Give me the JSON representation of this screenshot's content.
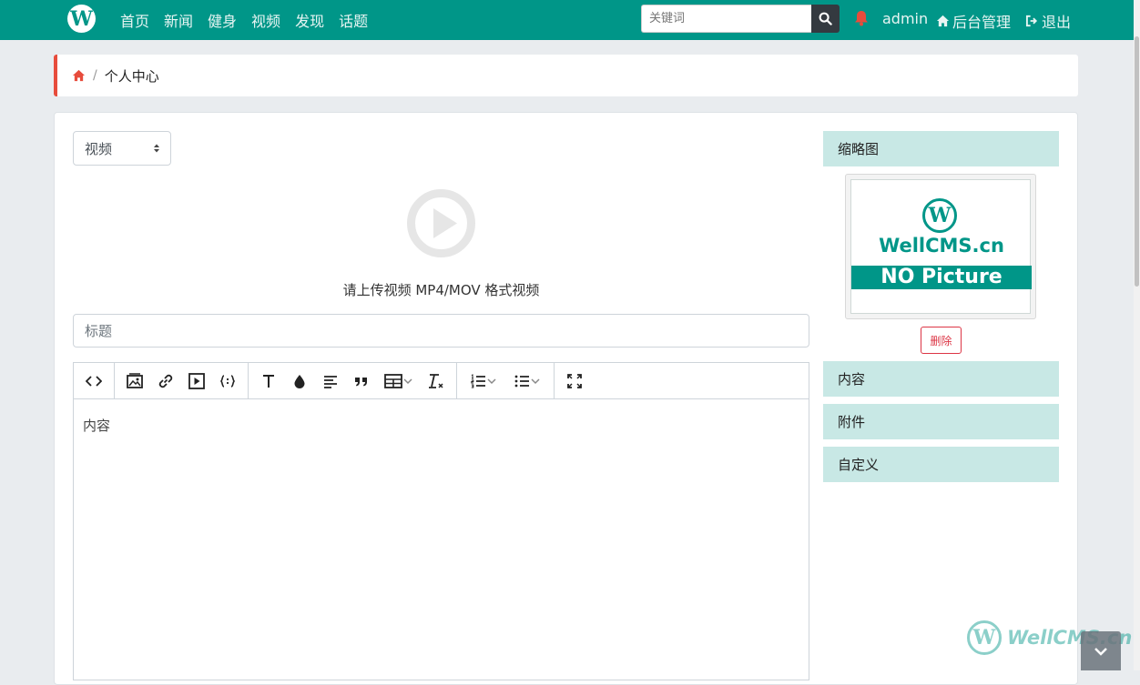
{
  "nav": {
    "logo_letter": "W",
    "links": [
      "首页",
      "新闻",
      "健身",
      "视频",
      "发现",
      "话题"
    ],
    "search_placeholder": "关键词",
    "username": "admin",
    "admin_label": "后台管理",
    "logout_label": "退出",
    "brand_color": "#009688"
  },
  "breadcrumb": {
    "separator": "/",
    "current": "个人中心"
  },
  "form": {
    "type_select_value": "视频",
    "upload_hint": "请上传视频 MP4/MOV 格式视频",
    "title_placeholder": "标题",
    "editor_placeholder": "内容"
  },
  "toolbar_icons": [
    "code-view-icon",
    "image-icon",
    "link-icon",
    "video-icon",
    "code-block-icon",
    "text-icon",
    "color-icon",
    "align-icon",
    "quote-icon",
    "table-icon",
    "clear-format-icon",
    "ordered-list-icon",
    "bullet-list-icon",
    "fullscreen-icon"
  ],
  "sidebar": {
    "thumbnail_header": "缩略图",
    "thumbnail_image": {
      "brand": "WellCMS.cn",
      "band_text": "NO Picture"
    },
    "delete_label": "删除",
    "panels": [
      "内容",
      "附件",
      "自定义"
    ]
  },
  "watermark": {
    "text": "WellCMS.cn"
  }
}
